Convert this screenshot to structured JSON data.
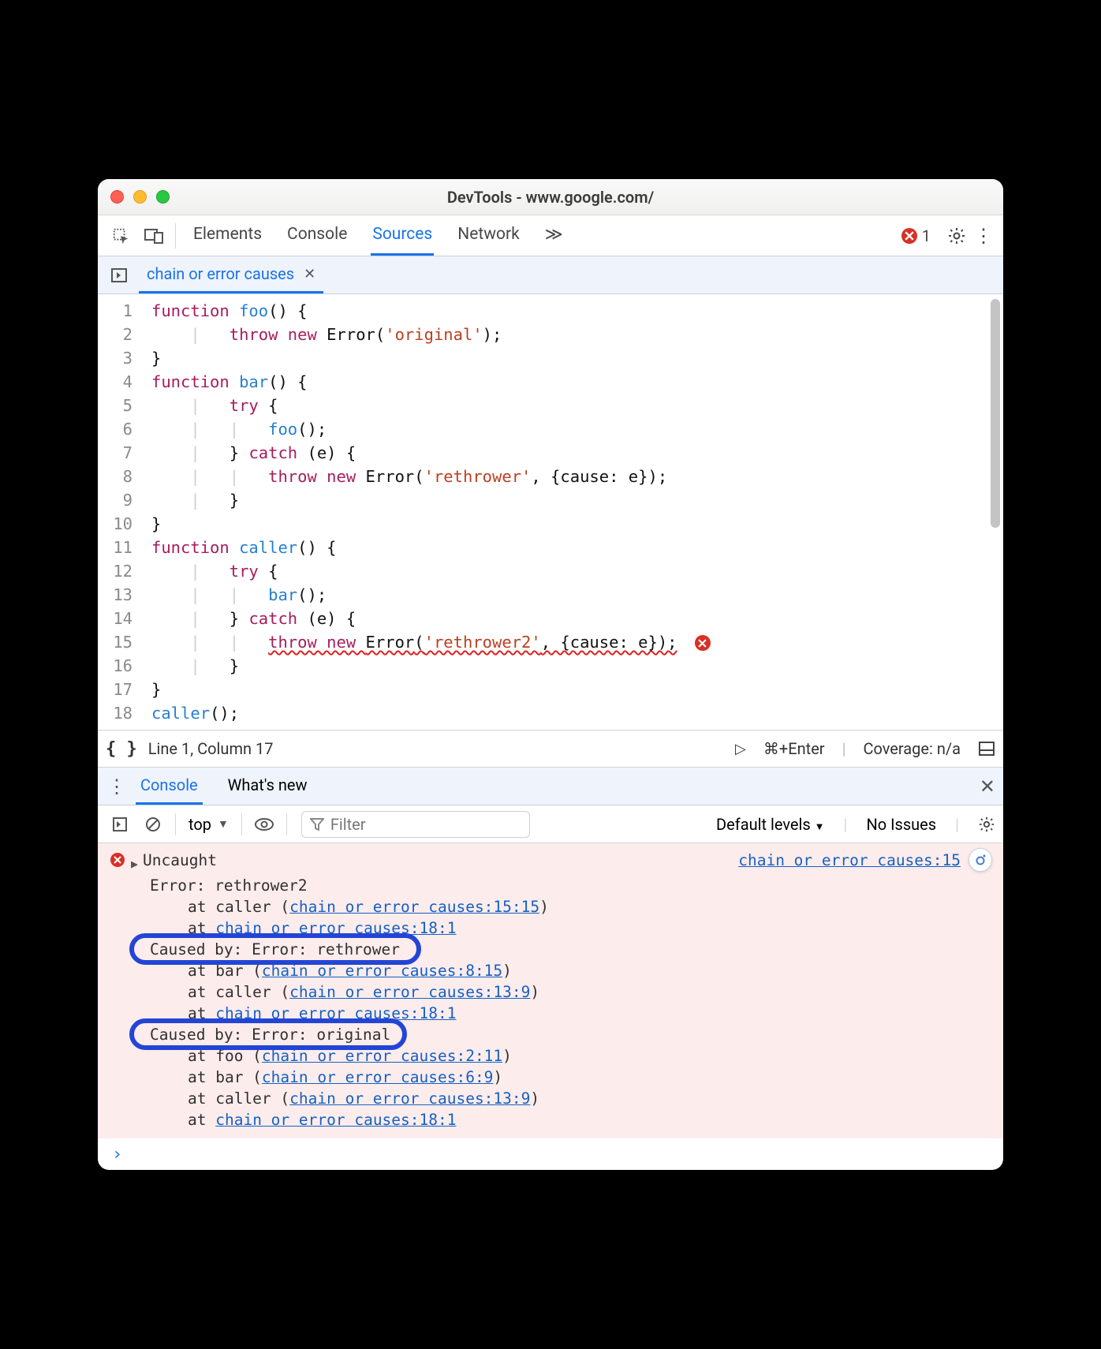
{
  "window": {
    "title": "DevTools - www.google.com/"
  },
  "toolbar": {
    "tabs": [
      "Elements",
      "Console",
      "Sources",
      "Network"
    ],
    "active_tab": "Sources",
    "overflow_glyph": "≫",
    "error_count": "1"
  },
  "file_tabs": {
    "active": "chain or error causes"
  },
  "code": {
    "lines": [
      {
        "n": "1",
        "seg": [
          [
            "kw",
            "function "
          ],
          [
            "fn",
            "foo"
          ],
          [
            "pln",
            "() {"
          ]
        ]
      },
      {
        "n": "2",
        "indent": 2,
        "seg": [
          [
            "kw",
            "throw new "
          ],
          [
            "cls",
            "Error"
          ],
          [
            "pln",
            "("
          ],
          [
            "str",
            "'original'"
          ],
          [
            "pln",
            ");"
          ]
        ]
      },
      {
        "n": "3",
        "seg": [
          [
            "pln",
            "}"
          ]
        ]
      },
      {
        "n": "4",
        "seg": [
          [
            "kw",
            "function "
          ],
          [
            "fn",
            "bar"
          ],
          [
            "pln",
            "() {"
          ]
        ]
      },
      {
        "n": "5",
        "indent": 2,
        "seg": [
          [
            "kw",
            "try "
          ],
          [
            "pln",
            "{"
          ]
        ]
      },
      {
        "n": "6",
        "indent": 3,
        "seg": [
          [
            "fn",
            "foo"
          ],
          [
            "pln",
            "();"
          ]
        ]
      },
      {
        "n": "7",
        "indent": 2,
        "seg": [
          [
            "pln",
            "} "
          ],
          [
            "kw",
            "catch "
          ],
          [
            "pln",
            "(e) {"
          ]
        ]
      },
      {
        "n": "8",
        "indent": 3,
        "seg": [
          [
            "kw",
            "throw new "
          ],
          [
            "cls",
            "Error"
          ],
          [
            "pln",
            "("
          ],
          [
            "str",
            "'rethrower'"
          ],
          [
            "pln",
            ", {cause: e});"
          ]
        ]
      },
      {
        "n": "9",
        "indent": 2,
        "seg": [
          [
            "pln",
            "}"
          ]
        ]
      },
      {
        "n": "10",
        "seg": [
          [
            "pln",
            "}"
          ]
        ]
      },
      {
        "n": "11",
        "seg": [
          [
            "kw",
            "function "
          ],
          [
            "fn",
            "caller"
          ],
          [
            "pln",
            "() {"
          ]
        ]
      },
      {
        "n": "12",
        "indent": 2,
        "seg": [
          [
            "kw",
            "try "
          ],
          [
            "pln",
            "{"
          ]
        ]
      },
      {
        "n": "13",
        "indent": 3,
        "seg": [
          [
            "fn",
            "bar"
          ],
          [
            "pln",
            "();"
          ]
        ]
      },
      {
        "n": "14",
        "indent": 2,
        "seg": [
          [
            "pln",
            "} "
          ],
          [
            "kw",
            "catch "
          ],
          [
            "pln",
            "(e) {"
          ]
        ]
      },
      {
        "n": "15",
        "indent": 3,
        "squiggle": true,
        "err": true,
        "seg": [
          [
            "kw",
            "throw new "
          ],
          [
            "cls",
            "Error"
          ],
          [
            "pln",
            "("
          ],
          [
            "str",
            "'rethrower2'"
          ],
          [
            "pln",
            ", {cause: e});"
          ]
        ]
      },
      {
        "n": "16",
        "indent": 2,
        "seg": [
          [
            "pln",
            "}"
          ]
        ]
      },
      {
        "n": "17",
        "seg": [
          [
            "pln",
            "}"
          ]
        ]
      },
      {
        "n": "18",
        "seg": [
          [
            "fn",
            "caller"
          ],
          [
            "pln",
            "();"
          ]
        ]
      }
    ]
  },
  "statusbar": {
    "position": "Line 1, Column 17",
    "run_hint": "⌘+Enter",
    "coverage": "Coverage: n/a"
  },
  "drawer": {
    "tabs": [
      "Console",
      "What's new"
    ],
    "active": "Console"
  },
  "console_toolbar": {
    "context": "top",
    "filter_placeholder": "Filter",
    "levels": "Default levels",
    "issues": "No Issues"
  },
  "console": {
    "src_right": "chain or error causes:15",
    "lines": [
      {
        "t": "head",
        "text": "Uncaught"
      },
      {
        "t": "plain",
        "text": "Error: rethrower2"
      },
      {
        "t": "at",
        "label": "at caller (",
        "link": "chain or error causes:15:15",
        "tail": ")"
      },
      {
        "t": "at",
        "label": "at ",
        "link": "chain or error causes:18:1",
        "tail": ""
      },
      {
        "t": "cause",
        "text": "Caused by: Error: rethrower",
        "hl": true
      },
      {
        "t": "at",
        "label": "at bar (",
        "link": "chain or error causes:8:15",
        "tail": ")"
      },
      {
        "t": "at",
        "label": "at caller (",
        "link": "chain or error causes:13:9",
        "tail": ")"
      },
      {
        "t": "at",
        "label": "at ",
        "link": "chain or error causes:18:1",
        "tail": ""
      },
      {
        "t": "cause",
        "text": "Caused by: Error: original",
        "hl": true
      },
      {
        "t": "at",
        "label": "at foo (",
        "link": "chain or error causes:2:11",
        "tail": ")"
      },
      {
        "t": "at",
        "label": "at bar (",
        "link": "chain or error causes:6:9",
        "tail": ")"
      },
      {
        "t": "at",
        "label": "at caller (",
        "link": "chain or error causes:13:9",
        "tail": ")"
      },
      {
        "t": "at",
        "label": "at ",
        "link": "chain or error causes:18:1",
        "tail": ""
      }
    ]
  },
  "prompt": "›"
}
